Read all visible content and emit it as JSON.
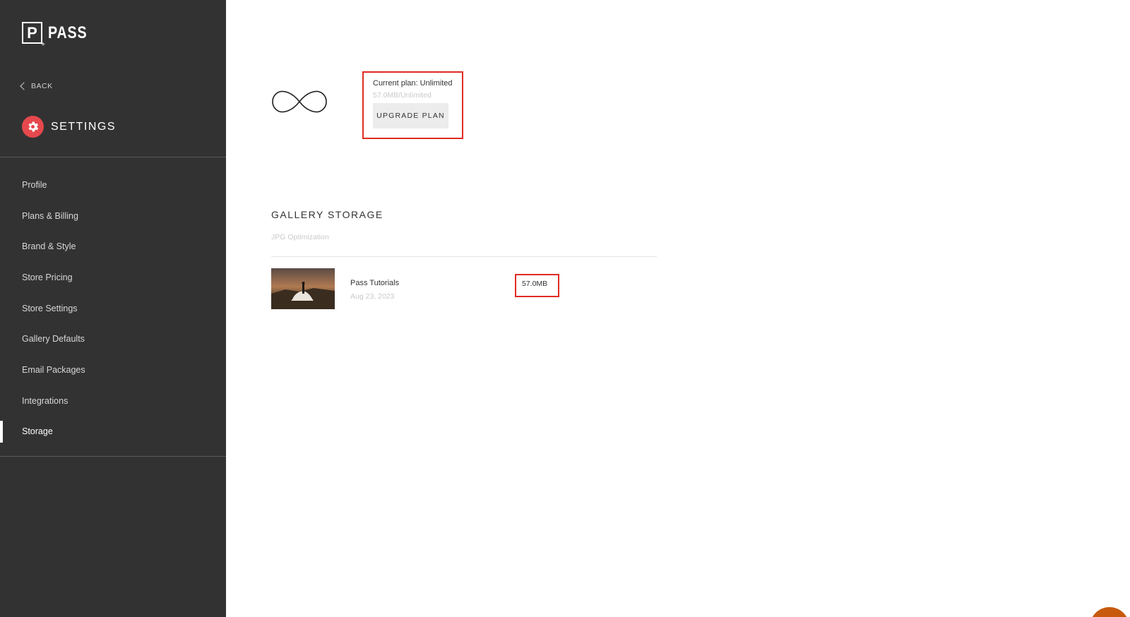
{
  "sidebar": {
    "logo": {
      "letter": "P",
      "text": "PASS"
    },
    "back_label": "BACK",
    "section_title": "SETTINGS",
    "items": [
      {
        "label": "Profile"
      },
      {
        "label": "Plans & Billing"
      },
      {
        "label": "Brand & Style"
      },
      {
        "label": "Store Pricing"
      },
      {
        "label": "Store Settings"
      },
      {
        "label": "Gallery Defaults"
      },
      {
        "label": "Email Packages"
      },
      {
        "label": "Integrations"
      },
      {
        "label": "Storage",
        "active": true
      }
    ]
  },
  "plan": {
    "icon": "infinity-icon",
    "current_label": "Current plan: Unlimited",
    "usage": "57.0MB/Unlimited",
    "upgrade_label": "UPGRADE PLAN"
  },
  "gallery_storage": {
    "title": "GALLERY STORAGE",
    "subtitle": "JPG Optimization",
    "rows": [
      {
        "name": "Pass Tutorials",
        "date": "Aug 23, 2023",
        "size": "57.0MB"
      }
    ]
  },
  "colors": {
    "sidebar_bg": "#333233",
    "accent_red": "#e5484d",
    "highlight_red": "#e12b23",
    "chat_orange": "#c75a0c"
  }
}
